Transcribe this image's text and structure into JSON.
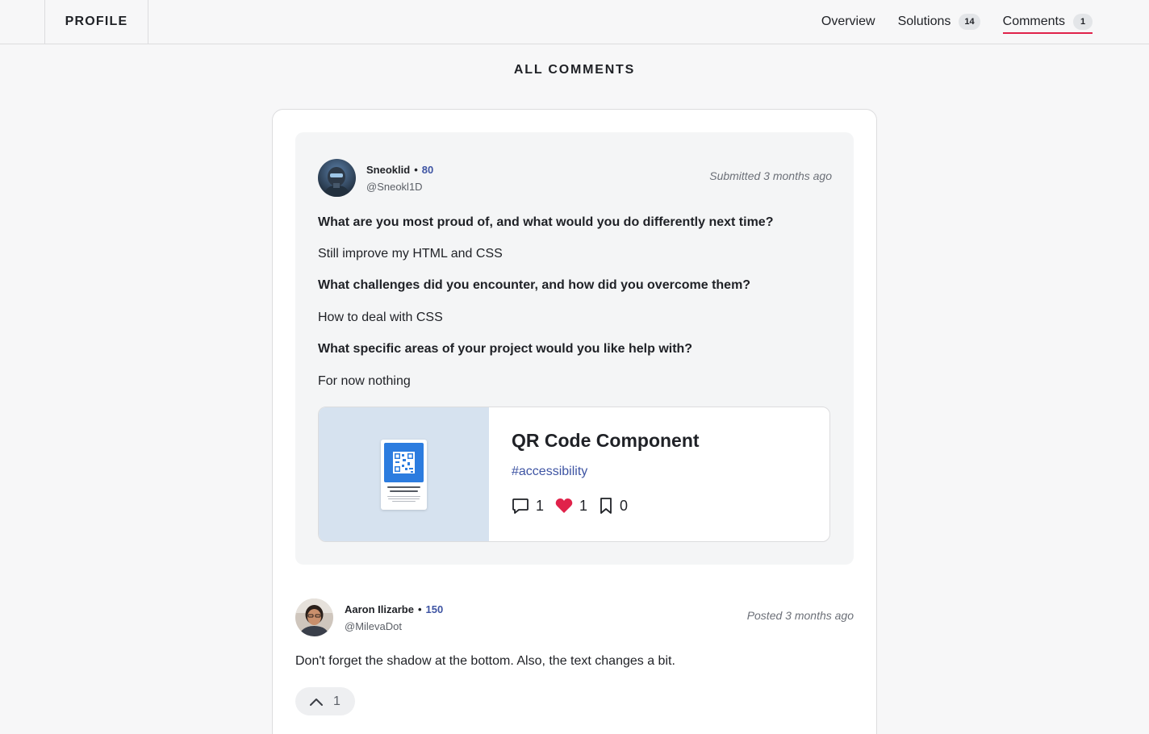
{
  "header": {
    "brand": "PROFILE",
    "tabs": [
      {
        "label": "Overview",
        "badge": null,
        "active": false
      },
      {
        "label": "Solutions",
        "badge": "14",
        "active": false
      },
      {
        "label": "Comments",
        "badge": "1",
        "active": true
      }
    ]
  },
  "page": {
    "title": "ALL COMMENTS"
  },
  "solution": {
    "author": {
      "name": "Sneoklid",
      "reputation": "80",
      "handle": "@Sneokl1D",
      "avatar_icon": "robot-avatar"
    },
    "submitted": "Submitted 3 months ago",
    "qa": [
      {
        "question": "What are you most proud of, and what would you do differently next time?",
        "answer": "Still improve my HTML and CSS"
      },
      {
        "question": "What challenges did you encounter, and how did you overcome them?",
        "answer": "How to deal with CSS"
      },
      {
        "question": "What specific areas of your project would you like help with?",
        "answer": "For now nothing"
      }
    ],
    "project": {
      "title": "QR Code Component",
      "tag": "#accessibility",
      "comments": "1",
      "likes": "1",
      "bookmarks": "0",
      "thumb_bg": "#d6e2ef"
    }
  },
  "comment": {
    "author": {
      "name": "Aaron Ilizarbe",
      "reputation": "150",
      "handle": "@MilevaDot",
      "avatar_icon": "person-avatar"
    },
    "posted": "Posted 3 months ago",
    "text": "Don't forget the shadow at the bottom. Also, the text changes a bit.",
    "upvotes": "1"
  },
  "colors": {
    "accent": "#e0224a",
    "link": "#3e54a3",
    "heart": "#e0224a"
  }
}
